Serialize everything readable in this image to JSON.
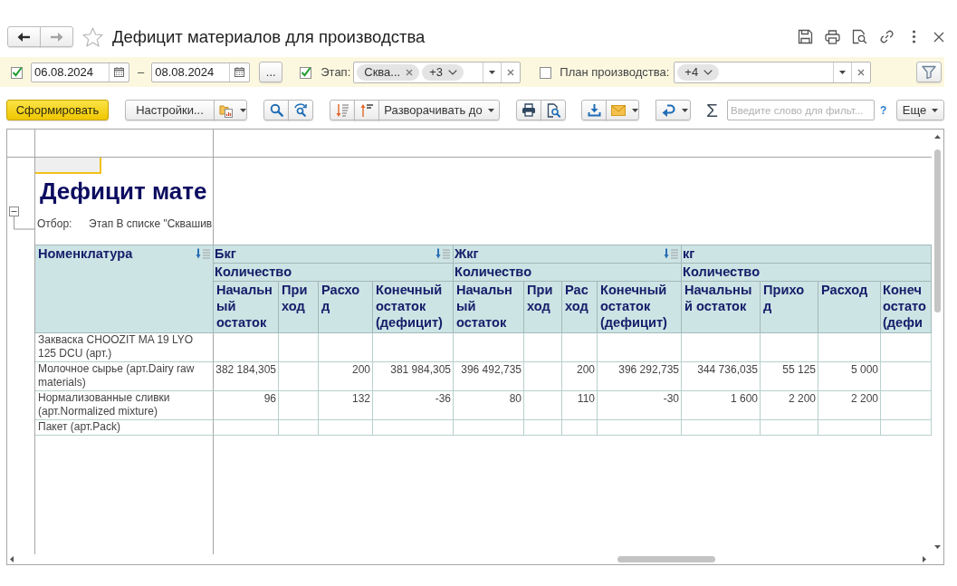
{
  "navigation": [
    {
      "kind": "back",
      "disabled": false
    },
    {
      "kind": "forward",
      "disabled": true
    }
  ],
  "window": {
    "title": "Дефицит материалов для производства",
    "favorite": false
  },
  "filter_bar": {
    "period": {
      "checked": true,
      "from": "06.08.2024",
      "dash": "–",
      "to": "08.08.2024",
      "choose_button": "..."
    },
    "filters": [
      {
        "checked": true,
        "label": "Этап:",
        "chips": [
          {
            "kind": "value",
            "text": "Сква..."
          },
          {
            "kind": "more",
            "text": "+3"
          }
        ]
      },
      {
        "checked": false,
        "label": "План производства:",
        "chips": [
          {
            "kind": "more",
            "text": "+4"
          }
        ]
      }
    ]
  },
  "toolbar": {
    "generate": "Сформировать",
    "settings": "Настройки...",
    "expand": "Разворачивать до",
    "sum": "Σ",
    "search": {
      "placeholder": "Введите слово для фильт..."
    },
    "help": "?",
    "more": "Еще"
  },
  "report": {
    "expanded": true,
    "title": "Дефицит мате",
    "filter_label": "Отбор:",
    "filter_value": "Этап В списке \"Сквашив",
    "table": {
      "row_header": {
        "label": "Номенклатура",
        "sort_icon": true
      },
      "groups": [
        {
          "name": "Бкг",
          "sort_icon": true,
          "measure": "Количество",
          "columns": [
            "Начальный остаток",
            "Приход",
            "Расход",
            "Конечный остаток (дефицит)"
          ]
        },
        {
          "name": "Жкг",
          "sort_icon": true,
          "measure": "Количество",
          "columns": [
            "Начальный остаток",
            "Приход",
            "Расход",
            "Конечный остаток (дефицит)"
          ]
        },
        {
          "name": "кг",
          "sort_icon": false,
          "measure": "Количество",
          "columns": [
            "Начальный остаток",
            "Приход",
            "Расход",
            "Конеч остато (дефи"
          ]
        }
      ],
      "rows": [
        {
          "name": "Закваска CHOOZIT MA 19 LYO 125 DCU (арт.)"
        },
        {
          "name": "Молочное сырье (арт.Dairy raw materials)",
          "groups": [
            {
              "opening": "382 184,305",
              "expense": "200",
              "closing": "381 984,305"
            },
            {
              "opening": "396 492,735",
              "expense": "200",
              "closing": "396 292,735"
            },
            {
              "opening": "344 736,035",
              "receipt": "55 125",
              "expense": "5 000"
            }
          ]
        },
        {
          "name": "Нормализованные сливки (арт.Normalized mixture)",
          "groups": [
            {
              "opening": "96",
              "expense": "132",
              "closing": "-36"
            },
            {
              "opening": "80",
              "expense": "110",
              "closing": "-30"
            },
            {
              "opening": "1 600",
              "receipt": "2 200",
              "expense": "2 200"
            }
          ]
        },
        {
          "name": "Пакет (арт.Pack)"
        }
      ]
    }
  }
}
